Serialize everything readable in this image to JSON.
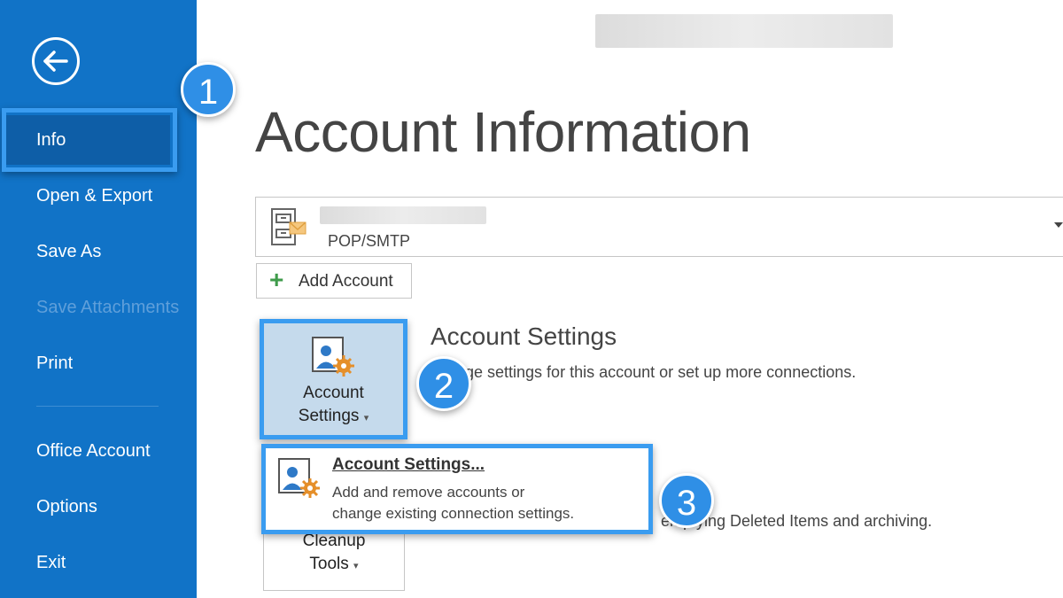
{
  "sidebar": {
    "back_icon": "back-arrow-icon",
    "items": [
      {
        "label": "Info",
        "state": "selected"
      },
      {
        "label": "Open & Export",
        "state": "normal"
      },
      {
        "label": "Save As",
        "state": "normal"
      },
      {
        "label": "Save Attachments",
        "state": "disabled"
      },
      {
        "label": "Print",
        "state": "normal"
      },
      {
        "label": "Office Account",
        "state": "normal"
      },
      {
        "label": "Options",
        "state": "normal"
      },
      {
        "label": "Exit",
        "state": "normal"
      }
    ],
    "color": "#1173c7"
  },
  "main": {
    "title": "Account Information",
    "account": {
      "type": "POP/SMTP",
      "icon": "mail-account-icon"
    },
    "add_account_label": "Add Account",
    "account_settings": {
      "tile_line1": "Account",
      "tile_line2": "Settings",
      "heading": "Account Settings",
      "description": "ge settings for this account or set up more connections."
    },
    "menu": {
      "title": "Account Settings...",
      "desc_line1": "Add and remove accounts or",
      "desc_line2": "change existing connection settings."
    },
    "cleanup": {
      "tile_line1": "Cleanup",
      "tile_line2": "Tools",
      "description": "emptying Deleted Items and archiving."
    }
  },
  "callouts": [
    "1",
    "2",
    "3"
  ],
  "accent_color": "#3a9cf0"
}
